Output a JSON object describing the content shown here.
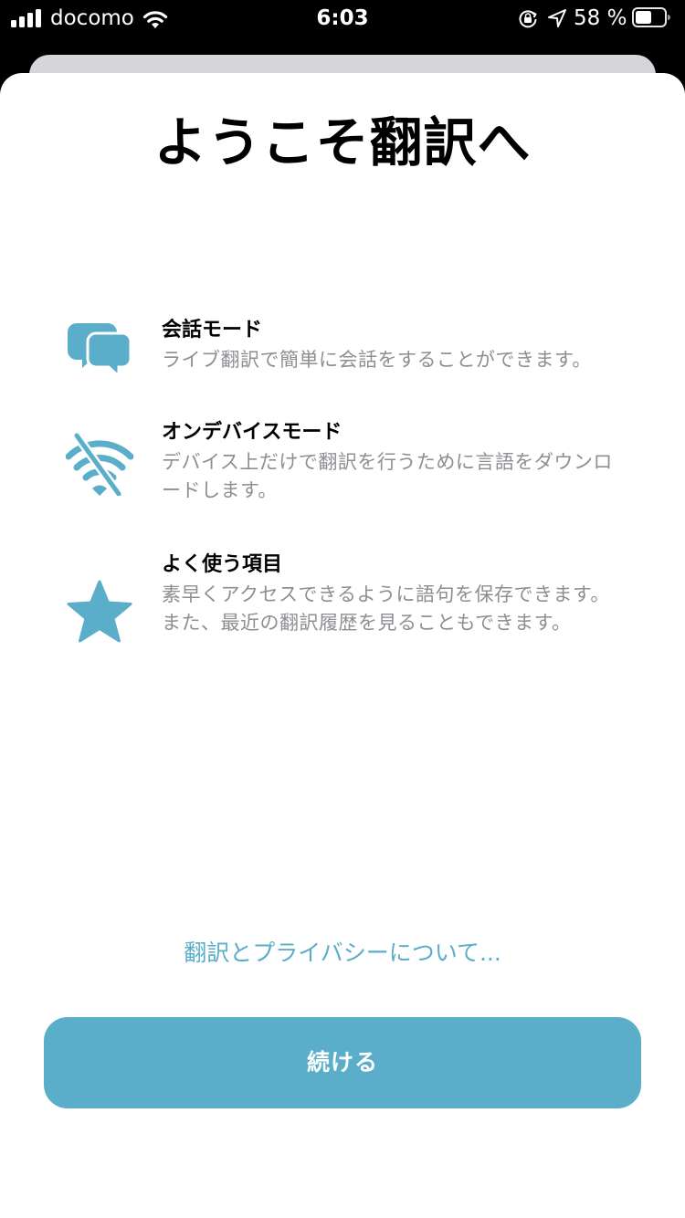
{
  "status_bar": {
    "carrier": "docomo",
    "time": "6:03",
    "battery_percent": "58 %",
    "battery_level": 0.58
  },
  "sheet": {
    "title": "ようこそ翻訳へ",
    "features": [
      {
        "icon": "chat-bubbles-icon",
        "title": "会話モード",
        "description": "ライブ翻訳で簡単に会話をすることができます。"
      },
      {
        "icon": "wifi-off-icon",
        "title": "オンデバイスモード",
        "description": "デバイス上だけで翻訳を行うために言語をダウンロードします。"
      },
      {
        "icon": "star-icon",
        "title": "よく使う項目",
        "description": "素早くアクセスできるように語句を保存できます。また、最近の翻訳履歴を見ることもできます。"
      }
    ],
    "privacy_link": "翻訳とプライバシーについて...",
    "continue_label": "続ける"
  },
  "colors": {
    "accent": "#5aaec9",
    "secondary_text": "#8e8e93",
    "back_card": "#d6d6da"
  }
}
